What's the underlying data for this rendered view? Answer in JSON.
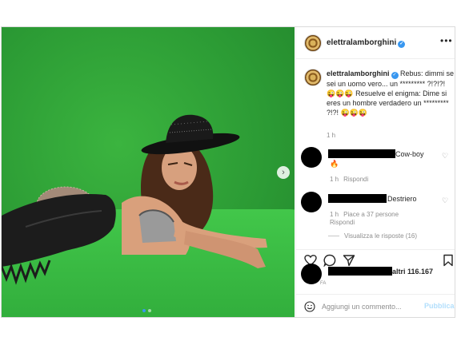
{
  "post": {
    "username": "elettralamborghini",
    "more_label": "•••"
  },
  "caption": {
    "username": "elettralamborghini",
    "text": "Rebus: dimmi se sei un uomo vero... un ********* ?!?!?! 😜😜😜 Resuelve el enigma: Dime si eres un hombre verdadero un ********* ?!?! 😜😜😜",
    "time": "1 h"
  },
  "comments": [
    {
      "text": "Cow-boy",
      "emoji": "🔥",
      "time": "1 h",
      "reply_label": "Rispondi"
    },
    {
      "text": "Destriero",
      "time": "1 h",
      "likes_label": "Piace a 37 persone",
      "reply_label": "Rispondi"
    }
  ],
  "view_replies": "Visualizza le risposte (16)",
  "likes_text": "altri 116.167",
  "date_small": "FA",
  "add_comment": {
    "placeholder": "Aggiungi un commento...",
    "publish_label": "Pubblica"
  },
  "photo": {
    "next_label": "›",
    "carousel_pages": 2,
    "carousel_current": 1
  },
  "colors": {
    "verified_blue": "#3897f0",
    "publish_disabled": "#b2dffc",
    "green_screen": "#2fa038"
  }
}
